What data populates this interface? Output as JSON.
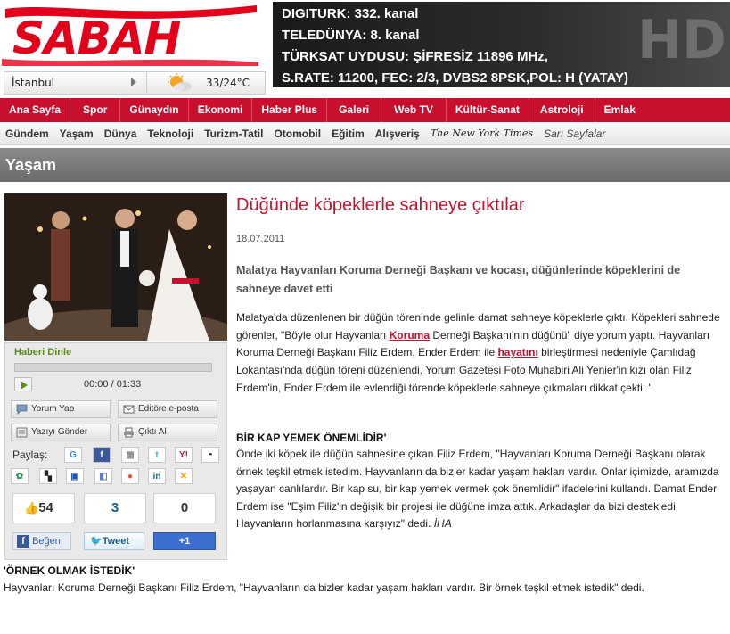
{
  "header": {
    "logo": "SABAH",
    "weather": {
      "city": "İstanbul",
      "temperature": "33/24°C"
    },
    "banner": {
      "lines": [
        "DIGITURK: 332. kanal",
        "TELEDÜNYA: 8. kanal",
        "TÜRKSAT UYDUSU: ŞİFRESİZ 11896 MHz,",
        "S.RATE: 11200, FEC: 2/3, DVBS2 8PSK,POL: H (YATAY)"
      ],
      "hd": "HD"
    }
  },
  "nav_primary": [
    "Ana Sayfa",
    "Spor",
    "Günaydın",
    "Ekonomi",
    "Haber Plus",
    "Galeri",
    "Web TV",
    "Kültür-Sanat",
    "Astroloji",
    "Emlak"
  ],
  "nav_secondary": [
    "Gündem",
    "Yaşam",
    "Dünya",
    "Teknoloji",
    "Turizm-Tatil",
    "Otomobil",
    "Eğitim",
    "Alışveriş",
    "The New York Times",
    "Sarı Sayfalar"
  ],
  "section": {
    "title": "Yaşam"
  },
  "player": {
    "title": "Haberi Dinle",
    "time": "00:00 / 01:33"
  },
  "actions": {
    "comment": "Yorum Yap",
    "email_editor": "Editöre e-posta",
    "send_to_printer": "Yazıyı Gönder",
    "print": "Çıktı Al"
  },
  "share": {
    "label": "Paylaş:"
  },
  "social": {
    "fb_count": "54",
    "tweet_count": "3",
    "plus_count": "0",
    "fb_like": "Beğen",
    "tweet": "Tweet",
    "plus": "+1"
  },
  "article": {
    "headline": "Düğünde köpeklerle sahneye çıktılar",
    "date": "18.07.2011",
    "lead": "Malatya Hayvanları Koruma Derneği Başkanı ve kocası, düğünlerinde köpeklerini de sahneye davet etti",
    "p1_a": "Malatya'da düzenlenen bir düğün töreninde gelinle damat sahneye köpeklerle çıktı. Köpekleri sahnede görenler, \"Böyle olur Hayvanları ",
    "p1_kw1": "Koruma",
    "p1_b": " Derneği Başkanı'nın düğünü\" diye yorum yaptı. Hayvanları Koruma Derneği Başkanı Filiz Erdem, Ender Erdem ile ",
    "p1_kw2": "hayatını",
    "p1_c": " birleştirmesi nedeniyle Çamlıdağ Lokantası'nda düğün töreni düzenlendi. Yorum Gazetesi Foto Muhabiri Ali Yenier'in kızı olan Filiz Erdem'in, Ender Erdem ile evlendiği törende köpeklerle sahneye çıkmaları dikkat çekti. '",
    "subhead1": "BİR KAP YEMEK ÖNEMLİDİR'",
    "p2": "Önde iki köpek ile düğün sahnesine çıkan Filiz Erdem, \"Hayvanları Koruma Derneği Başkanı olarak örnek teşkil etmek istedim. Hayvanların da bizler kadar yaşam hakları vardır. Onlar içimizde, aramızda yaşayan canlılardır. Bir kap su, bir kap yemek vermek çok önemlidir\" ifadelerini kullandı. Damat Ender Erdem ise \"Eşim Filiz'in değişik bir projesi ile düğüne imza attık. Arkadaşlar da bizi destekledi. Hayvanların horlanmasına karşıyız\" dedi.",
    "source": "İHA",
    "subhead2": "'ÖRNEK OLMAK İSTEDİK'",
    "p3": "Hayvanları Koruma Derneği Başkanı Filiz Erdem, \"Hayvanların da bizler kadar yaşam hakları vardır. Bir örnek teşkil etmek istedik\" dedi."
  },
  "colors": {
    "brand_red": "#c8102e",
    "section_gray": "#7a7a7a",
    "player_green": "#5a8a1e"
  }
}
